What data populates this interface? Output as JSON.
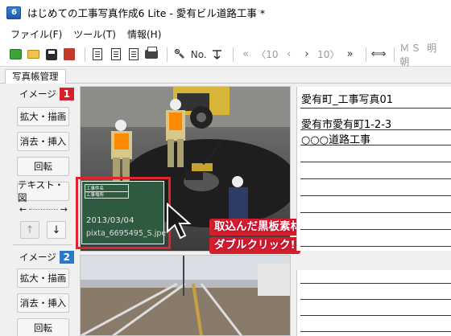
{
  "window": {
    "title": "はじめての工事写真作成6 Lite - 愛有ビル道路工事 *"
  },
  "menu": [
    "ファイル(F)",
    "ツール(T)",
    "情報(H)"
  ],
  "toolbar": {
    "no_label": "No.",
    "nav_label": "〈10",
    "nav_label_next": "10〉",
    "font_label": "ＭＳ 明朝",
    "icons": [
      "new-green-icon",
      "open-folder-icon",
      "save-disk-icon",
      "red-doc-icon",
      "page-preview-icon",
      "page-preview2-icon",
      "page-preview3-icon",
      "printer-icon",
      "settings-icon",
      "number-icon",
      "sort-icon",
      "first-icon",
      "prev10-icon",
      "prev-icon",
      "next-icon",
      "next10-icon",
      "last-icon",
      "swap-icon"
    ]
  },
  "tabs": {
    "active": "写真帳管理"
  },
  "left_panel": {
    "image1_label": "イメージ",
    "image1_number": "1",
    "image2_label": "イメージ",
    "image2_number": "2",
    "buttons1": [
      "拡大・描画",
      "消去・挿入",
      "回転",
      "テキスト・図"
    ],
    "arrow_left": "←",
    "arrow_right": "→",
    "up_arrow": "↑",
    "down_arrow": "↓",
    "buttons2": [
      "拡大・描画",
      "消去・挿入",
      "回転"
    ]
  },
  "board": {
    "row1": "工事件名",
    "row2": "工事場所",
    "date": "2013/03/04",
    "file": "pixta_6695495_S.jpe"
  },
  "callout": {
    "line1": "取込んだ黒板素材を",
    "line2": "ダブルクリック!"
  },
  "info1": {
    "line1": "愛有町_工事写真01",
    "line2": "愛有市愛有町1-2-3",
    "line3": "○○○道路工事"
  },
  "colors": {
    "accent_red": "#d8202a",
    "accent_blue": "#2b78c9",
    "board_green": "#2e5b40"
  }
}
